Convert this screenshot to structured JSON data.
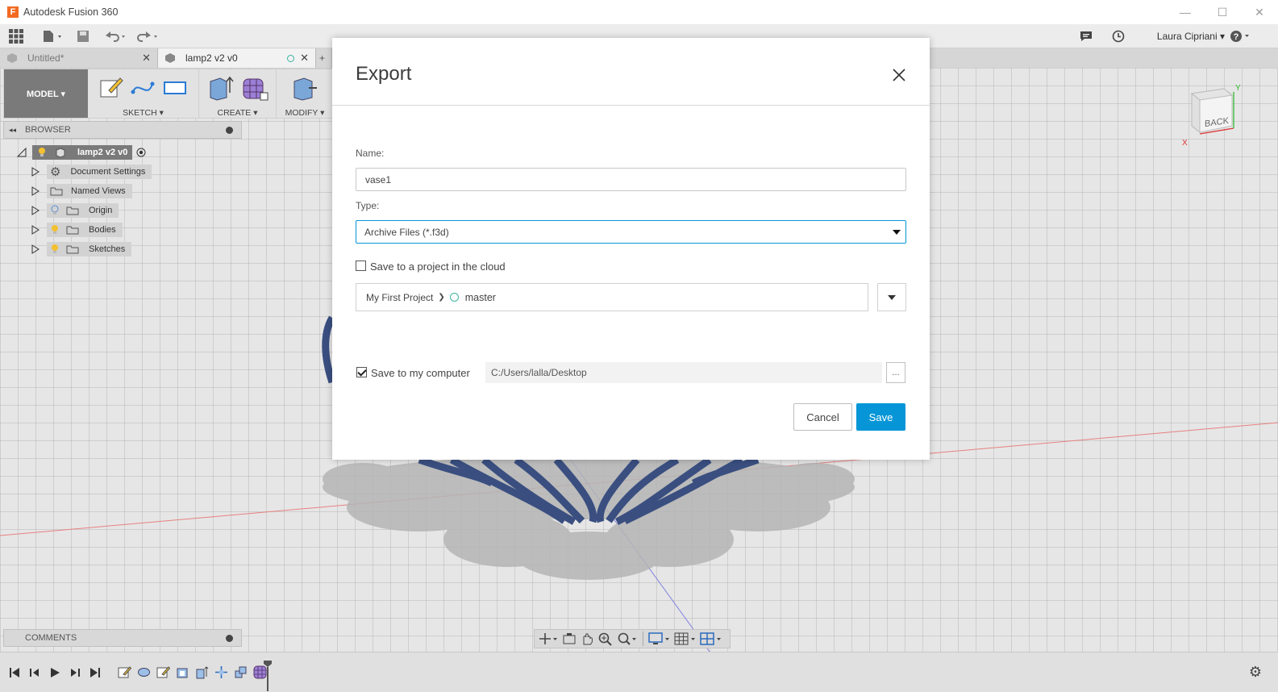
{
  "app": {
    "title": "Autodesk Fusion 360",
    "logo_letter": "F"
  },
  "window": {
    "minimize": "—",
    "maximize": "☐",
    "close": "✕"
  },
  "topbar": {
    "user": "Laura Cipriani ▾",
    "help": "?"
  },
  "tabs": [
    {
      "label": "Untitled*",
      "close": "✕"
    },
    {
      "label": "lamp2 v2 v0",
      "close": "✕"
    },
    {
      "label": "+"
    }
  ],
  "ribbon": {
    "workspace": "MODEL ▾",
    "groups": [
      "SKETCH ▾",
      "CREATE ▾",
      "MODIFY ▾"
    ]
  },
  "browser": {
    "title": "BROWSER",
    "root": "lamp2 v2 v0",
    "items": [
      "Document Settings",
      "Named Views",
      "Origin",
      "Bodies",
      "Sketches"
    ]
  },
  "comments": {
    "title": "COMMENTS"
  },
  "viewcube": {
    "face": "BACK",
    "axis_x": "X",
    "axis_y": "Y"
  },
  "dialog": {
    "title": "Export",
    "name_label": "Name:",
    "name_value": "vase1",
    "type_label": "Type:",
    "type_value": "Archive Files (*.f3d)",
    "cloud_label": "Save to a project in the cloud",
    "cloud_checked": false,
    "project": "My First Project",
    "project_sep": "❯",
    "branch": "master",
    "computer_label": "Save to my computer",
    "computer_checked": true,
    "path": "C:/Users/lalla/Desktop",
    "browse": "...",
    "cancel": "Cancel",
    "save": "Save"
  },
  "colors": {
    "accent": "#0696d7",
    "workspace": "#7a7a7a",
    "branch_circle": "#3cb4a0",
    "model_blue": "#3a4f80"
  }
}
